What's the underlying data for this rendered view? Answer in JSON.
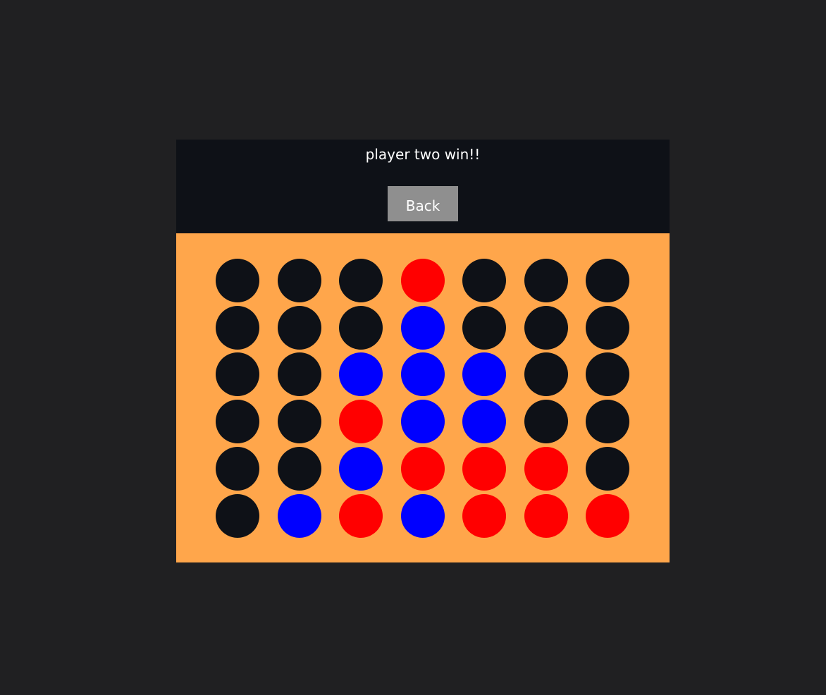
{
  "status": {
    "message": "player two win!!"
  },
  "controls": {
    "back_label": "Back"
  },
  "colors": {
    "empty": "#0e1117",
    "player_one": "#ff0000",
    "player_two": "#0000ff",
    "board": "#ffa64b",
    "header": "#0e1117"
  },
  "board": {
    "rows": 6,
    "cols": 7,
    "cells": [
      [
        "empty",
        "empty",
        "empty",
        "red",
        "empty",
        "empty",
        "empty"
      ],
      [
        "empty",
        "empty",
        "empty",
        "blue",
        "empty",
        "empty",
        "empty"
      ],
      [
        "empty",
        "empty",
        "blue",
        "blue",
        "blue",
        "empty",
        "empty"
      ],
      [
        "empty",
        "empty",
        "red",
        "blue",
        "blue",
        "empty",
        "empty"
      ],
      [
        "empty",
        "empty",
        "blue",
        "red",
        "red",
        "red",
        "empty"
      ],
      [
        "empty",
        "blue",
        "red",
        "blue",
        "red",
        "red",
        "red"
      ]
    ]
  }
}
